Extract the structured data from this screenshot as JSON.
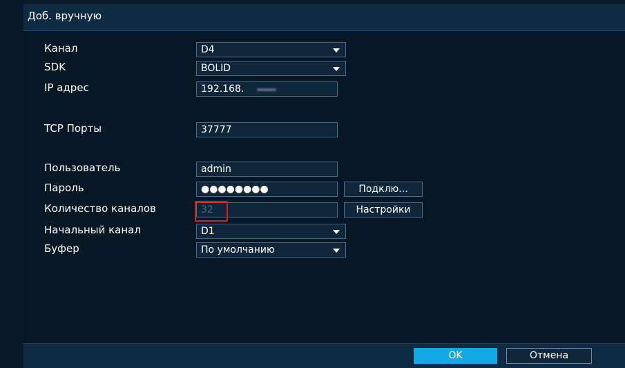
{
  "dialog": {
    "title": "Доб. вручную"
  },
  "form": {
    "channel_label": "Канал",
    "channel_value": "D4",
    "sdk_label": "SDK",
    "sdk_value": "BOLID",
    "ip_label": "IP адрес",
    "ip_value": "192.168.",
    "tcp_label": "TCP Порты",
    "tcp_value": "37777",
    "user_label": "Пользователь",
    "user_value": "admin",
    "password_label": "Пароль",
    "password_value": "●●●●●●●●",
    "connect_button": "Подклю...",
    "channel_count_label": "Количество каналов",
    "channel_count_value": "32",
    "settings_button": "Настройки",
    "start_channel_label": "Начальный канал",
    "start_channel_value": "D1",
    "buffer_label": "Буфер",
    "buffer_value": "По умолчанию"
  },
  "footer": {
    "ok_label": "OK",
    "cancel_label": "Отмена"
  },
  "colors": {
    "background": "#071726",
    "title_bar": "#0f2a43",
    "field_border": "#4f6c86",
    "ok_button": "#13a7e6",
    "highlight": "#e01b1b"
  }
}
